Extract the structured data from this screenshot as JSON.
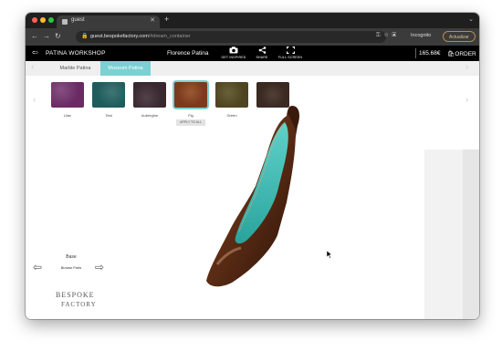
{
  "browser": {
    "tab_title": "guest",
    "url_host": "guest.bespokefactory.com",
    "url_path": "/#dream_container",
    "profile": "Incognito",
    "update_button": "Actualizar"
  },
  "site": {
    "brand": "PATINA WORKSHOP",
    "owner": "Florence Patina",
    "toolbar": [
      {
        "label": "GET INSPIRED",
        "icon": "camera-icon"
      },
      {
        "label": "SHARE",
        "icon": "share-icon"
      },
      {
        "label": "FULL SCREEN",
        "icon": "fullscreen-icon"
      }
    ],
    "price": "165.68€",
    "order": "ORDER"
  },
  "pattern_tabs": [
    {
      "label": "Marble Patina",
      "active": false
    },
    {
      "label": "Museum Patina",
      "active": true
    }
  ],
  "swatches": [
    {
      "label": "Lilac",
      "color": "#6b2a64"
    },
    {
      "label": "Teal",
      "color": "#1f5c5c"
    },
    {
      "label": "Aubergine",
      "color": "#3a2830"
    },
    {
      "label": "Fig",
      "color": "#7a3a1c",
      "selected": true
    },
    {
      "label": "Green",
      "color": "#4e4520"
    },
    {
      "label": "",
      "color": "#3a2a22"
    }
  ],
  "apply_all": "APPLY TO ALL",
  "base": {
    "title": "Base",
    "subtitle": "Browse Parts"
  },
  "logo": {
    "line1": "BESPOKE",
    "line2": "FACTORY"
  },
  "colors": {
    "accent": "#7bd0d3",
    "leather": "#5a2c14",
    "lining": "#3cb7b0"
  }
}
